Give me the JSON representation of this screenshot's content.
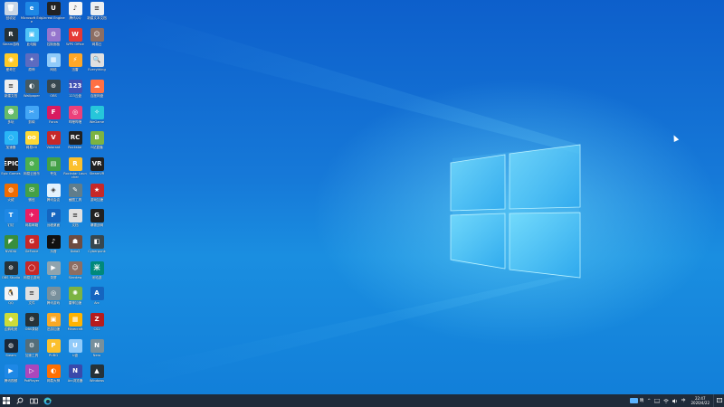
{
  "desktop": {
    "icons": [
      {
        "label": "回收站",
        "color": "#c9d6e6",
        "glyph": "🗑"
      },
      {
        "label": "Microsoft Edge",
        "color": "#1e88e5",
        "glyph": "e"
      },
      {
        "label": "Unreal Engine",
        "color": "#222222",
        "glyph": "U"
      },
      {
        "label": "腾讯QQ",
        "color": "#f5f5f5",
        "glyph": "♪"
      },
      {
        "label": "新建文本文档",
        "color": "#eceff1",
        "glyph": "≡"
      },
      {
        "label": "Steam游戏",
        "color": "#263238",
        "glyph": "R"
      },
      {
        "label": "此电脑",
        "color": "#4fc3f7",
        "glyph": "▣"
      },
      {
        "label": "控制面板",
        "color": "#9575cd",
        "glyph": "⚙"
      },
      {
        "label": "WPS Office",
        "color": "#e53935",
        "glyph": "W"
      },
      {
        "label": "网易云",
        "color": "#8d6e63",
        "glyph": "☺"
      },
      {
        "label": "爱奇艺",
        "color": "#ffca28",
        "glyph": "◉"
      },
      {
        "label": "原神",
        "color": "#5c6bc0",
        "glyph": "✦"
      },
      {
        "label": "网络",
        "color": "#90caf9",
        "glyph": "▦"
      },
      {
        "label": "迅雷",
        "color": "#ffa726",
        "glyph": "⚡"
      },
      {
        "label": "Everything",
        "color": "#e0e0e0",
        "glyph": "🔍"
      },
      {
        "label": "新建文档",
        "color": "#eeeeee",
        "glyph": "≡"
      },
      {
        "label": "Wallpaper",
        "color": "#455a64",
        "glyph": "◐"
      },
      {
        "label": "OBS",
        "color": "#37474f",
        "glyph": "⊙"
      },
      {
        "label": "123云盘",
        "color": "#3f51b5",
        "glyph": "123"
      },
      {
        "label": "百度网盘",
        "color": "#ff7043",
        "glyph": "☁"
      },
      {
        "label": "多玩",
        "color": "#66bb6a",
        "glyph": "☻"
      },
      {
        "label": "剪映",
        "color": "#42a5f5",
        "glyph": "✂"
      },
      {
        "label": "Forza",
        "color": "#d81b60",
        "glyph": "F"
      },
      {
        "label": "哔哩哔哩",
        "color": "#ec407a",
        "glyph": "◎"
      },
      {
        "label": "WeGame",
        "color": "#26c6da",
        "glyph": "✧"
      },
      {
        "label": "加速器",
        "color": "#29b6f6",
        "glyph": "◌"
      },
      {
        "label": "网易UU",
        "color": "#fdd835",
        "glyph": "oo"
      },
      {
        "label": "Valorant",
        "color": "#c62828",
        "glyph": "V"
      },
      {
        "label": "Rockstar",
        "color": "#212121",
        "glyph": "RC"
      },
      {
        "label": "B站直播",
        "color": "#7cb342",
        "glyph": "B"
      },
      {
        "label": "Epic Games",
        "color": "#212121",
        "glyph": "EPIC"
      },
      {
        "label": "网易云音乐",
        "color": "#4caf50",
        "glyph": "⊘"
      },
      {
        "label": "夸克",
        "color": "#43a047",
        "glyph": "▤"
      },
      {
        "label": "Rockstar Launcher",
        "color": "#fbc02d",
        "glyph": "R"
      },
      {
        "label": "SteamVR",
        "color": "#212121",
        "glyph": "VR"
      },
      {
        "label": "火绒",
        "color": "#ef6c00",
        "glyph": "◍"
      },
      {
        "label": "微信",
        "color": "#43a047",
        "glyph": "✉"
      },
      {
        "label": "腾讯会议",
        "color": "#e3f2fd",
        "glyph": "◈"
      },
      {
        "label": "截图工具",
        "color": "#607d8b",
        "glyph": "✎"
      },
      {
        "label": "游戏加速",
        "color": "#c62828",
        "glyph": "★"
      },
      {
        "label": "钉钉",
        "color": "#1e88e5",
        "glyph": "T"
      },
      {
        "label": "网易邮箱",
        "color": "#e91e63",
        "glyph": "✈"
      },
      {
        "label": "远程桌面",
        "color": "#1565c0",
        "glyph": "P"
      },
      {
        "label": "文档",
        "color": "#e0e0e0",
        "glyph": "≡"
      },
      {
        "label": "暴雪战网",
        "color": "#212121",
        "glyph": "G"
      },
      {
        "label": "NVIDIA",
        "color": "#388e3c",
        "glyph": "◤"
      },
      {
        "label": "GeForce",
        "color": "#c62828",
        "glyph": "G"
      },
      {
        "label": "抖音",
        "color": "#111111",
        "glyph": "♪"
      },
      {
        "label": "Dota2",
        "color": "#6d4c41",
        "glyph": "☗"
      },
      {
        "label": "Cyberpunk",
        "color": "#37474f",
        "glyph": "◧"
      },
      {
        "label": "OBS Studio",
        "color": "#263238",
        "glyph": "⊙"
      },
      {
        "label": "网易云游戏",
        "color": "#c62828",
        "glyph": "◯"
      },
      {
        "label": "录屏",
        "color": "#90a4ae",
        "glyph": "▶"
      },
      {
        "label": "Stardew",
        "color": "#8d6e63",
        "glyph": "☺"
      },
      {
        "label": "米哈游",
        "color": "#00897b",
        "glyph": "米"
      },
      {
        "label": "QQ",
        "color": "#f5f5f5",
        "glyph": "🐧"
      },
      {
        "label": "文件",
        "color": "#e0e0e0",
        "glyph": "≡"
      },
      {
        "label": "腾讯游戏",
        "color": "#78909c",
        "glyph": "◎"
      },
      {
        "label": "雷神加速",
        "color": "#7cb342",
        "glyph": "✺"
      },
      {
        "label": "Arc",
        "color": "#1565c0",
        "glyph": "A"
      },
      {
        "label": "企鹅电竞",
        "color": "#cddc39",
        "glyph": "◆"
      },
      {
        "label": "OBS录制",
        "color": "#263238",
        "glyph": "⊙"
      },
      {
        "label": "迅游加速",
        "color": "#f9a825",
        "glyph": "▣"
      },
      {
        "label": "Minecraft",
        "color": "#ffb300",
        "glyph": "▦"
      },
      {
        "label": "CS2",
        "color": "#b71c1c",
        "glyph": "Z"
      },
      {
        "label": "Steam",
        "color": "#1b2838",
        "glyph": "◍"
      },
      {
        "label": "加速工具",
        "color": "#546e7a",
        "glyph": "⚙"
      },
      {
        "label": "PUBG",
        "color": "#fbc02d",
        "glyph": "P"
      },
      {
        "label": "U盘",
        "color": "#90caf9",
        "glyph": "U"
      },
      {
        "label": "Nero",
        "color": "#78909c",
        "glyph": "N"
      },
      {
        "label": "腾讯视频",
        "color": "#1e88e5",
        "glyph": "▶"
      },
      {
        "label": "PotPlayer",
        "color": "#ab47bc",
        "glyph": "▷"
      },
      {
        "label": "网易大神",
        "color": "#ff6f00",
        "glyph": "◐"
      },
      {
        "label": "Arc浏览器",
        "color": "#3949ab",
        "glyph": "N"
      },
      {
        "label": "Windows",
        "color": "#263238",
        "glyph": "▲"
      }
    ]
  },
  "taskbar": {
    "weather": "晴",
    "time": "22:47",
    "date": "2020/4/22",
    "lang": "中"
  }
}
